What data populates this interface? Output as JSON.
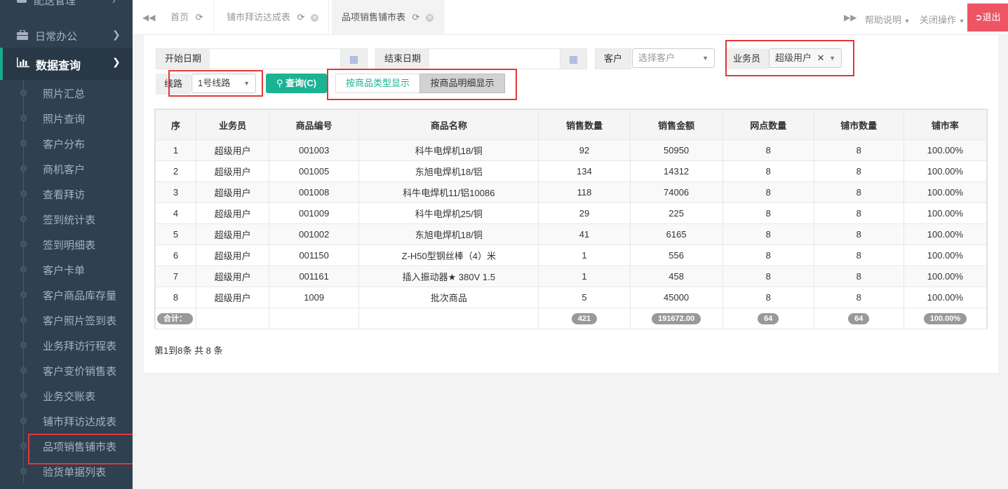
{
  "sidebar": {
    "top_item": "配送管理",
    "daily": "日常办公",
    "query": "数据查询",
    "items": [
      "照片汇总",
      "照片查询",
      "客户分布",
      "商机客户",
      "查看拜访",
      "签到统计表",
      "签到明细表",
      "客户卡单",
      "客户商品库存量",
      "客户照片签到表",
      "业务拜访行程表",
      "客户变价销售表",
      "业务交账表",
      "铺市拜访达成表",
      "品项销售铺市表",
      "验货单据列表"
    ]
  },
  "tabs": {
    "home": "首页",
    "tab1": "铺市拜访达成表",
    "tab2": "品项销售铺市表",
    "help": "帮助说明",
    "close_ops": "关闭操作",
    "logout": "退出"
  },
  "filters": {
    "start_date_label": "开始日期",
    "end_date_label": "结束日期",
    "customer_label": "客户",
    "customer_placeholder": "选择客户",
    "salesman_label": "业务员",
    "salesman_value": "超级用户",
    "route_label": "线路",
    "route_value": "1号线路",
    "query_button": "查询(C)",
    "by_type_button": "按商品类型显示",
    "by_detail_button": "按商品明细显示"
  },
  "table": {
    "headers": [
      "序",
      "业务员",
      "商品编号",
      "商品名称",
      "销售数量",
      "销售金额",
      "网点数量",
      "铺市数量",
      "铺市率"
    ],
    "rows": [
      [
        "1",
        "超级用户",
        "001003",
        "科牛电焊机18/铜",
        "92",
        "50950",
        "8",
        "8",
        "100.00%"
      ],
      [
        "2",
        "超级用户",
        "001005",
        "东旭电焊机18/铝",
        "134",
        "14312",
        "8",
        "8",
        "100.00%"
      ],
      [
        "3",
        "超级用户",
        "001008",
        "科牛电焊机11/铝10086",
        "118",
        "74006",
        "8",
        "8",
        "100.00%"
      ],
      [
        "4",
        "超级用户",
        "001009",
        "科牛电焊机25/铜",
        "29",
        "225",
        "8",
        "8",
        "100.00%"
      ],
      [
        "5",
        "超级用户",
        "001002",
        "东旭电焊机18/铜",
        "41",
        "6165",
        "8",
        "8",
        "100.00%"
      ],
      [
        "6",
        "超级用户",
        "001150",
        "Z-H50型钢丝棒（4）米",
        "1",
        "556",
        "8",
        "8",
        "100.00%"
      ],
      [
        "7",
        "超级用户",
        "001161",
        "插入振动器★ 380V 1.5",
        "1",
        "458",
        "8",
        "8",
        "100.00%"
      ],
      [
        "8",
        "超级用户",
        "1009",
        "批次商品",
        "5",
        "45000",
        "8",
        "8",
        "100.00%"
      ]
    ],
    "footer": {
      "label": "合计：",
      "qty": "421",
      "amount": "191672.00",
      "outlets": "64",
      "coverage": "64",
      "rate": "100.00%"
    }
  },
  "pager_text": "第1到8条 共 8 条",
  "colors": {
    "sidebar_bg": "#2f4050",
    "accent": "#1ab394",
    "logout": "#ed5565",
    "highlight_box": "#e13838"
  }
}
